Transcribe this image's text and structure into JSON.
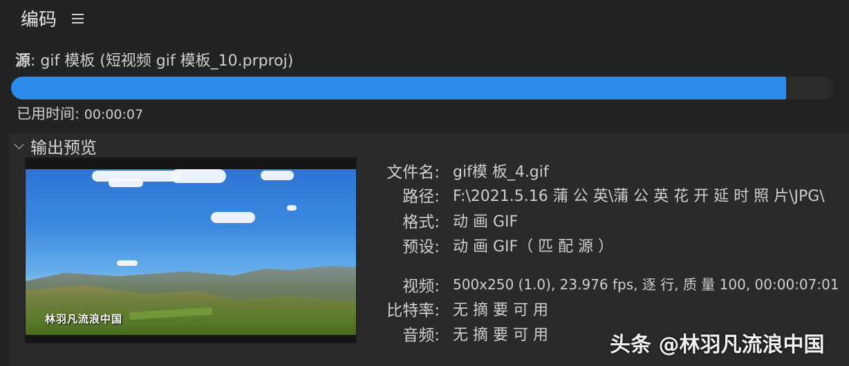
{
  "header": {
    "title": "编码"
  },
  "source": {
    "label": "源",
    "value": ": gif 模板 (短视频 gif 模板_10.prproj)"
  },
  "progress": {
    "percent": 94.2
  },
  "elapsed": {
    "label": "已用时间:",
    "value": "00:00:07"
  },
  "preview": {
    "section_title": "输出预览",
    "watermark_text": "林羽凡流浪中国"
  },
  "info": {
    "filename_label": "文件名:",
    "filename_value": "gif模 板_4.gif",
    "path_label": "路径:",
    "path_value": "F:\\2021.5.16 蒲 公 英\\蒲 公 英 花 开 延 时 照 片\\JPG\\",
    "format_label": "格式:",
    "format_value": "动 画 GIF",
    "preset_label": "预设:",
    "preset_value": "动 画 GIF（ 匹 配 源 ）",
    "video_label": "视频:",
    "video_value": "500x250 (1.0), 23.976 fps, 逐 行, 质 量 100, 00:00:07:01",
    "bitrate_label": "比特率:",
    "bitrate_value": "无 摘 要 可 用",
    "audio_label": "音频:",
    "audio_value": "无 摘 要 可 用"
  },
  "watermark": "头条 @林羽凡流浪中国"
}
